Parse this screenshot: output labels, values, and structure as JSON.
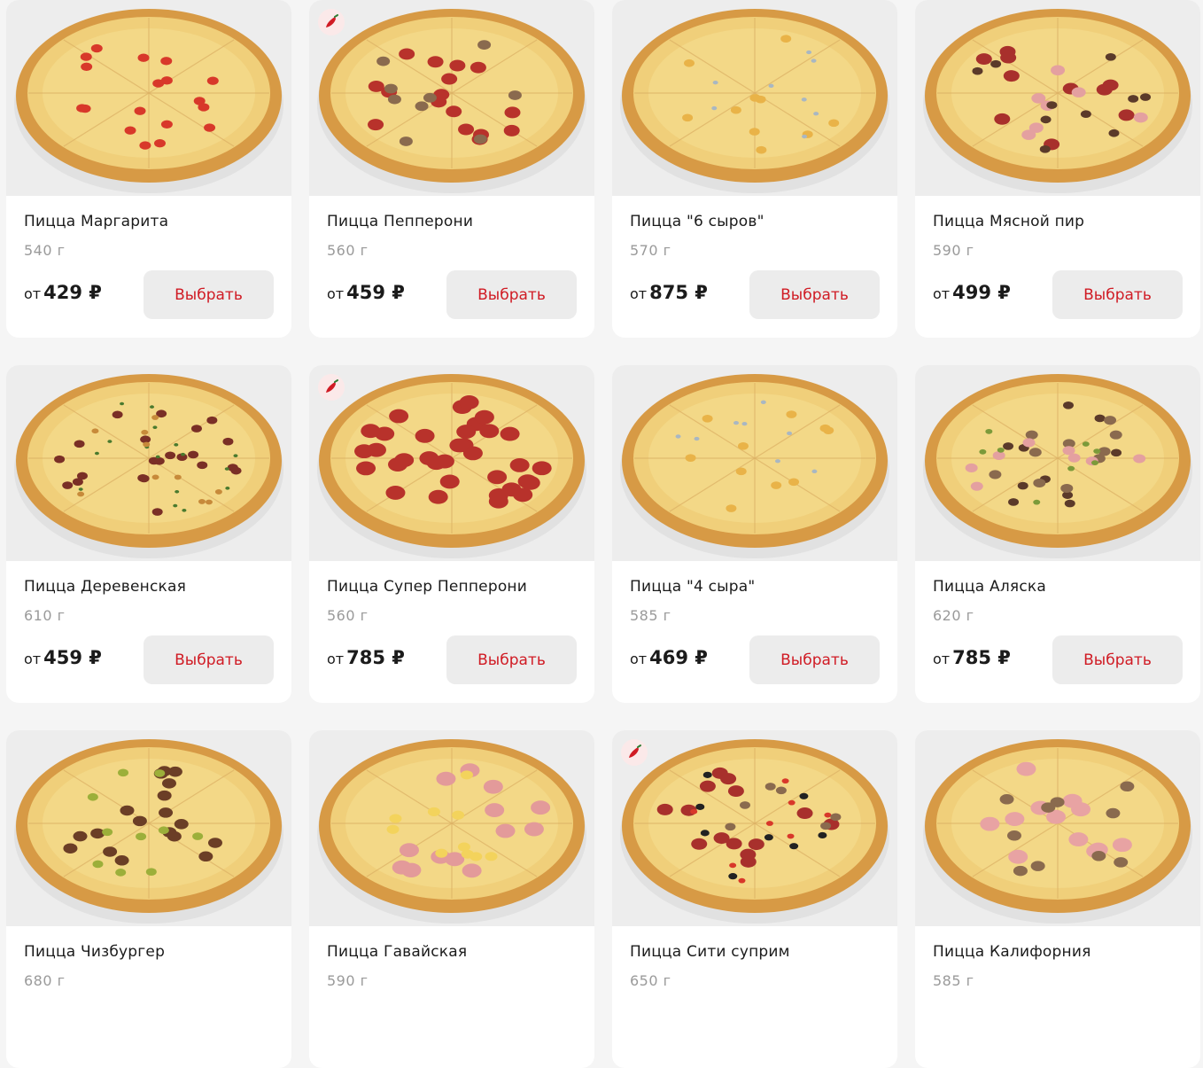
{
  "menu": {
    "colors": {
      "accent": "#d01b24",
      "button_bg": "#ececec",
      "card_bg": "#ffffff",
      "page_bg": "#f5f5f5",
      "weight_text": "#9a9a9a"
    },
    "spicy_icon": "chili-pepper-icon",
    "price_prefix": "от",
    "button_label": "Выбрать",
    "items": [
      {
        "name": "Пицца Маргарита",
        "weight": "540 г",
        "price": "429 ₽",
        "spicy": false,
        "topping": "tomato"
      },
      {
        "name": "Пицца Пепперони",
        "weight": "560 г",
        "price": "459 ₽",
        "spicy": true,
        "topping": "pepperoni-mushroom"
      },
      {
        "name": "Пицца \"6 сыров\"",
        "weight": "570 г",
        "price": "875 ₽",
        "spicy": false,
        "topping": "cheese"
      },
      {
        "name": "Пицца Мясной пир",
        "weight": "590 г",
        "price": "499 ₽",
        "spicy": false,
        "topping": "meat"
      },
      {
        "name": "Пицца Деревенская",
        "weight": "610 г",
        "price": "459 ₽",
        "spicy": false,
        "topping": "village"
      },
      {
        "name": "Пицца Супер Пепперони",
        "weight": "560 г",
        "price": "785 ₽",
        "spicy": true,
        "topping": "pepperoni"
      },
      {
        "name": "Пицца \"4 сыра\"",
        "weight": "585 г",
        "price": "469 ₽",
        "spicy": false,
        "topping": "cheese"
      },
      {
        "name": "Пицца Аляска",
        "weight": "620 г",
        "price": "785 ₽",
        "spicy": false,
        "topping": "alaska"
      },
      {
        "name": "Пицца Чизбургер",
        "weight": "680 г",
        "price": "",
        "spicy": false,
        "topping": "burger"
      },
      {
        "name": "Пицца Гавайская",
        "weight": "590 г",
        "price": "",
        "spicy": false,
        "topping": "ham"
      },
      {
        "name": "Пицца Сити суприм",
        "weight": "650 г",
        "price": "",
        "spicy": true,
        "topping": "supreme"
      },
      {
        "name": "Пицца Калифорния",
        "weight": "585 г",
        "price": "",
        "spicy": false,
        "topping": "california"
      }
    ]
  }
}
